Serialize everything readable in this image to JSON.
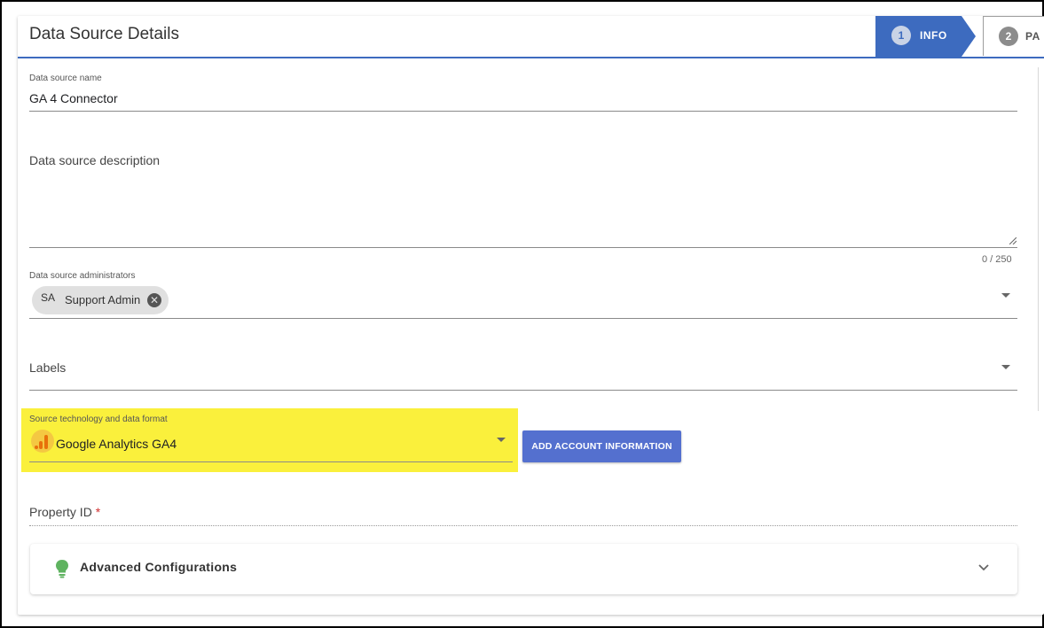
{
  "header": {
    "title": "Data Source Details",
    "steps": [
      {
        "number": "1",
        "label": "INFO",
        "active": true
      },
      {
        "number": "2",
        "label": "PA",
        "active": false
      }
    ]
  },
  "form": {
    "name": {
      "label": "Data source name",
      "value": "GA 4 Connector"
    },
    "description": {
      "label": "Data source description",
      "value": "",
      "counter": "0 / 250"
    },
    "administrators": {
      "label": "Data source administrators",
      "chips": [
        {
          "avatar": "SA",
          "name": "Support Admin"
        }
      ]
    },
    "labels": {
      "label": "Labels"
    },
    "source_technology": {
      "label": "Source technology and data format",
      "value": "Google Analytics GA4"
    },
    "add_account_button": "ADD ACCOUNT INFORMATION",
    "property_id": {
      "label": "Property ID",
      "required_mark": "*"
    },
    "advanced": {
      "title": "Advanced Configurations"
    }
  },
  "colors": {
    "accent": "#3d6bbf",
    "button": "#5470cf",
    "highlight": "#faf03c",
    "required": "#d03030",
    "bulb": "#5fb360"
  }
}
